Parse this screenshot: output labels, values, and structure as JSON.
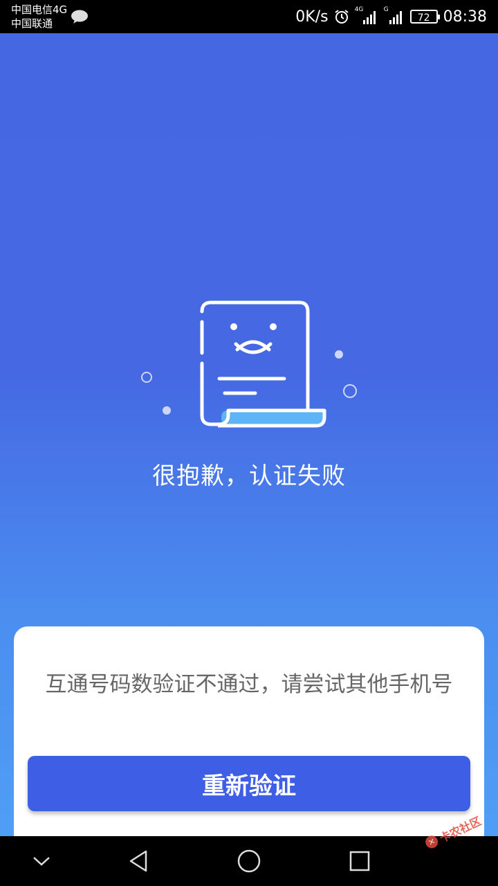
{
  "status_bar": {
    "carrier_1": "中国电信4G",
    "carrier_2": "中国联通",
    "net_speed": "0K/s",
    "net_type_1": "4G",
    "net_type_2": "G",
    "battery": "72",
    "time": "08:38"
  },
  "result": {
    "title": "很抱歉，认证失败",
    "message": "互通号码数验证不通过，请尝试其他手机号",
    "retry_label": "重新验证"
  },
  "watermark": {
    "text": "卡农社区"
  },
  "colors": {
    "background_top": "#4568e2",
    "background_bottom": "#4f9ef5",
    "button": "#3f5ee6",
    "accent_light": "#5fb3f7"
  },
  "icons": [
    "message-icon",
    "alarm-icon",
    "signal-icon",
    "battery-icon",
    "document-fail-icon",
    "back-icon",
    "home-icon",
    "recents-icon",
    "collapse-icon"
  ]
}
